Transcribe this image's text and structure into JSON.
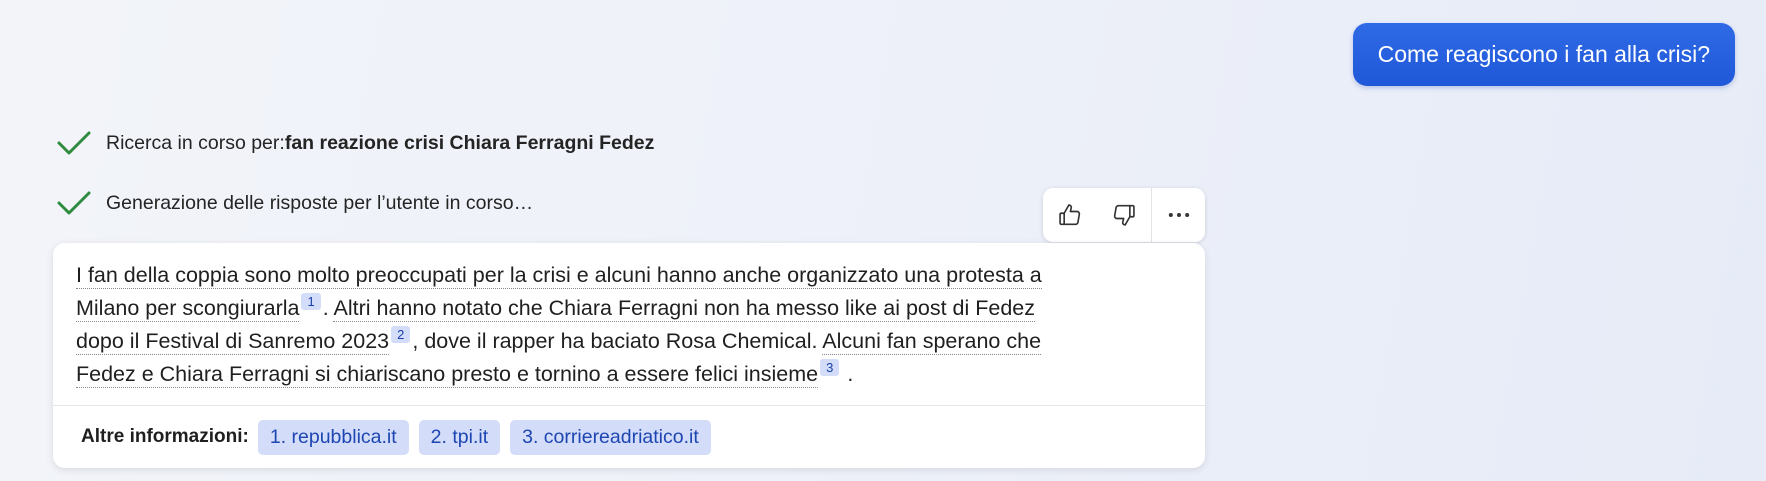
{
  "user_message": "Come reagiscono i fan alla crisi?",
  "status": [
    {
      "prefix": "Ricerca in corso per: ",
      "query": "fan reazione crisi Chiara Ferragni Fedez"
    },
    {
      "prefix": "Generazione delle risposte per l’utente in corso…",
      "query": ""
    }
  ],
  "answer": {
    "line1": "I fan della coppia sono molto preoccupati per la crisi e alcuni hanno anche organizzato una protesta a",
    "line2": "Milano per scongiurarla",
    "cite1": "1",
    "sep1": ". ",
    "line2b": "Altri hanno notato che Chiara Ferragni non ha messo like ai post di Fedez",
    "line3": "dopo il Festival di Sanremo 2023",
    "cite2": "2",
    "line3b": ", dove il rapper ha baciato Rosa Chemical. ",
    "line3c": "Alcuni fan sperano che",
    "line4": "Fedez e Chiara Ferragni si chiariscano presto e tornino a essere felici insieme",
    "cite3": "3",
    "end": "."
  },
  "footer": {
    "label": "Altre informazioni:",
    "sources": [
      "1. repubblica.it",
      "2. tpi.it",
      "3. corriereadriatico.it"
    ]
  },
  "colors": {
    "user_bubble": "#2563e0",
    "check": "#2e8b3e",
    "cite_bg": "#d3dcf8"
  }
}
